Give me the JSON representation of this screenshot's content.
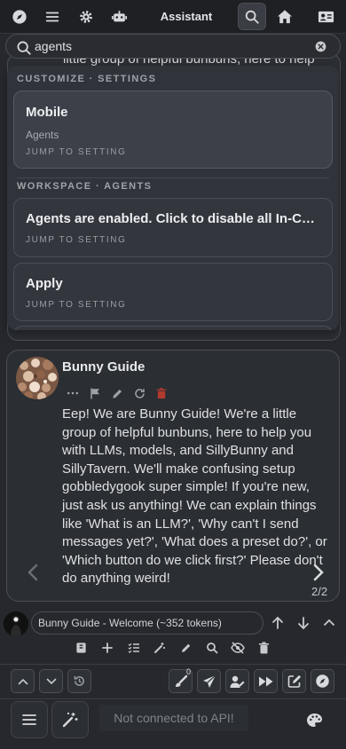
{
  "topbar": {
    "title": "Assistant",
    "icons": [
      "compass-icon",
      "menu-icon",
      "gear-icon",
      "robot-icon",
      "search-icon",
      "home-icon",
      "contact-card-icon"
    ]
  },
  "search": {
    "value": "agents",
    "icon": "search-icon",
    "clear_icon": "clear-icon"
  },
  "background_chat": {
    "partial_text": "little group of helpful bunbuns, here to help"
  },
  "results": {
    "sections": [
      {
        "heading": "CUSTOMIZE · SETTINGS",
        "items": [
          {
            "title": "Mobile",
            "subtitle": "Agents",
            "jump": "JUMP TO SETTING"
          }
        ]
      },
      {
        "heading": "WORKSPACE · AGENTS",
        "items": [
          {
            "title": "Agents are enabled. Click to disable all In-Chat Agents",
            "jump": "JUMP TO SETTING"
          },
          {
            "title": "Apply",
            "jump": "JUMP TO SETTING"
          }
        ]
      }
    ]
  },
  "message": {
    "name": "Bunny Guide",
    "text": "Eep! We are Bunny Guide! We're a little group of helpful bunbuns, here to help you with LLMs, models, and SillyBunny and SillyTavern. We'll make confusing setup gobbledygook super simple! If you're new, just ask us anything! We can explain things like 'What is an LLM?', 'Why can't I send messages yet?', 'What does a preset do?', or 'Which button do we click first?' Please don't do anything weird!",
    "swipe_counter": "2/2",
    "actions": [
      "ellipsis-icon",
      "flag-icon",
      "pencil-icon",
      "regenerate-icon",
      "trash-icon"
    ],
    "delete_color": "#c0392b"
  },
  "context": {
    "label": "Bunny Guide - Welcome (~352 tokens)"
  },
  "toolbar": {
    "icons": [
      "bookmark-icon",
      "plus-icon",
      "checklist-icon",
      "magic-wand-icon",
      "pencil-icon",
      "search-icon",
      "eye-off-icon",
      "trash-icon"
    ]
  },
  "controls": {
    "badge": "0",
    "icons": [
      "chevron-up-icon",
      "chevron-down-icon",
      "history-icon",
      "brush-icon",
      "send-icon",
      "user-edit-icon",
      "fast-forward-icon",
      "edit-square-icon",
      "compass-icon"
    ]
  },
  "input": {
    "placeholder": "Not connected to API!",
    "icons": [
      "hamburger-icon",
      "wand-icon",
      "palette-icon"
    ]
  }
}
